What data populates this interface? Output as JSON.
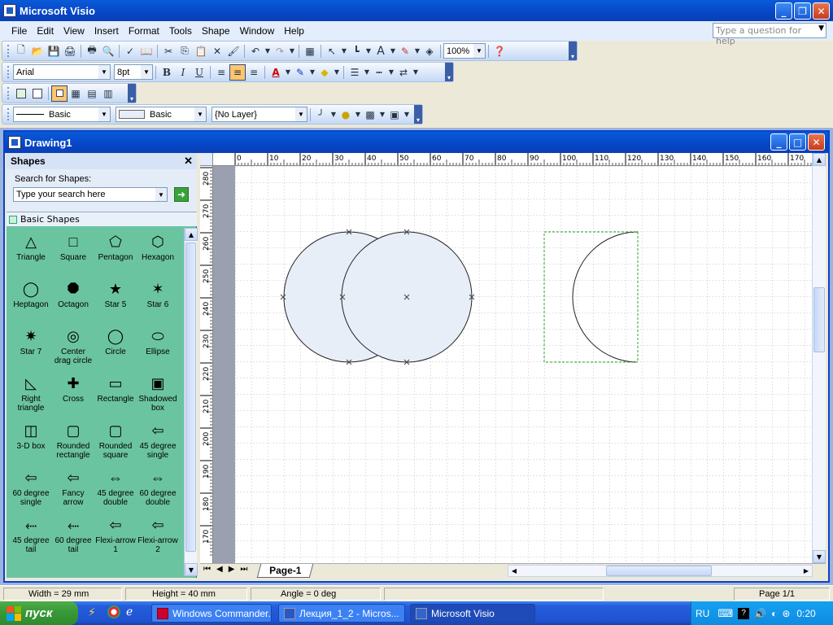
{
  "app": {
    "title": "Microsoft Visio",
    "drawing_title": "Drawing1"
  },
  "menu": [
    "File",
    "Edit",
    "View",
    "Insert",
    "Format",
    "Tools",
    "Shape",
    "Window",
    "Help"
  ],
  "ask_placeholder": "Type a question for help",
  "toolbar": {
    "zoom": "100%",
    "font": "Arial",
    "size": "8pt",
    "line_style": "Basic",
    "fill_style": "Basic",
    "layer": "{No Layer}"
  },
  "shapes_panel": {
    "title": "Shapes",
    "search_label": "Search for Shapes:",
    "search_placeholder": "Type your search here",
    "stencil": "Basic Shapes",
    "items": [
      "Triangle",
      "Square",
      "Pentagon",
      "Hexagon",
      "Heptagon",
      "Octagon",
      "Star 5",
      "Star 6",
      "Star 7",
      "Center drag circle",
      "Circle",
      "Ellipse",
      "Right triangle",
      "Cross",
      "Rectangle",
      "Shadowed box",
      "3-D box",
      "Rounded rectangle",
      "Rounded square",
      "45 degree single",
      "60 degree single",
      "Fancy arrow",
      "45 degree double",
      "60 degree double",
      "45 degree tail",
      "60 degree tail",
      "Flexi-arrow 1",
      "Flexi-arrow 2"
    ]
  },
  "rulers": {
    "h": [
      "0",
      "10",
      "20",
      "30",
      "40",
      "50",
      "60",
      "70",
      "80",
      "90",
      "100",
      "110",
      "120",
      "130",
      "140",
      "150",
      "160",
      "170"
    ],
    "v": [
      "280",
      "270",
      "260",
      "250",
      "240",
      "230",
      "220",
      "210",
      "200",
      "190",
      "180",
      "170"
    ]
  },
  "page_tab": "Page-1",
  "status": {
    "width": "Width = 29 mm",
    "height": "Height = 40 mm",
    "angle": "Angle = 0 deg",
    "page": "Page 1/1"
  },
  "taskbar": {
    "start": "пуск",
    "tasks": [
      "Windows Commander...",
      "Лекция_1_2 - Micros...",
      "Microsoft Visio"
    ],
    "lang": "RU",
    "time": "0:20"
  },
  "colors": {
    "xp_blue": "#0546C7",
    "stencil_bg": "#6BC4A0",
    "shape_fill": "#E8EEF8"
  }
}
